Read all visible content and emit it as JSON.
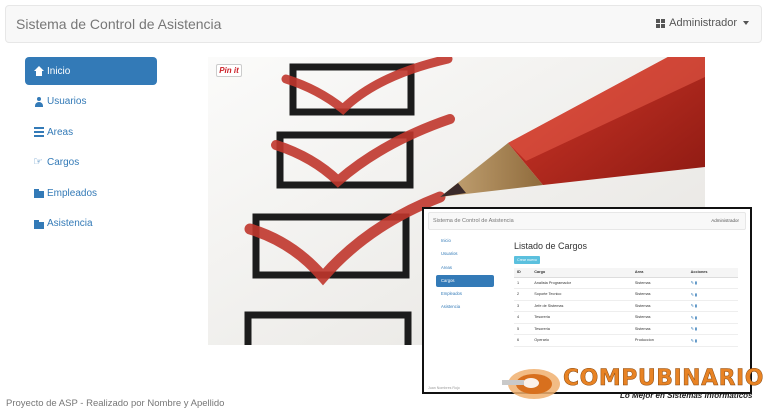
{
  "app": {
    "title": "Sistema de Control de Asistencia",
    "user_menu": "Administrador"
  },
  "sidebar": {
    "items": [
      {
        "label": "Inicio",
        "icon": "home-icon",
        "active": true
      },
      {
        "label": "Usuarios",
        "icon": "user-icon"
      },
      {
        "label": "Areas",
        "icon": "list-icon"
      },
      {
        "label": "Cargos",
        "icon": "hand-point-icon"
      },
      {
        "label": "Empleados",
        "icon": "folder-icon"
      },
      {
        "label": "Asistencia",
        "icon": "folder-icon"
      }
    ]
  },
  "hero": {
    "pin_label": "Pin it",
    "image": "checklist-with-red-pencil"
  },
  "inset": {
    "brand": "Sistema de Control de Asistencia",
    "user_menu": "Administrador",
    "nav": [
      "Inicio",
      "Usuarios",
      "Areas",
      "Cargos",
      "Empleados",
      "Asistencia"
    ],
    "page_title": "Listado de Cargos",
    "new_button": "Crear nuevo Cargo",
    "columns": [
      "ID",
      "Cargo",
      "Area",
      "Acciones"
    ],
    "rows": [
      {
        "id": "1",
        "cargo": "Analista Programador",
        "area": "Sistemas"
      },
      {
        "id": "2",
        "cargo": "Soporte Tecnico",
        "area": "Sistemas"
      },
      {
        "id": "3",
        "cargo": "Jefe de Sistemas",
        "area": "Sistemas"
      },
      {
        "id": "4",
        "cargo": "Tesoreria",
        "area": "Sistemas"
      },
      {
        "id": "5",
        "cargo": "Tesoreria",
        "area": "Sistemas"
      },
      {
        "id": "6",
        "cargo": "Operario",
        "area": "Produccion"
      }
    ],
    "footer": "Juan Nombres Rojo"
  },
  "watermark": {
    "brand": "COMPUBINARIO",
    "tagline": "Lo Mejor en Sistemas Informáticos"
  },
  "footer": {
    "text": "Proyecto de ASP - Realizado por Nombre y Apellido"
  },
  "colors": {
    "primary": "#337ab7",
    "navbar_bg": "#f8f8f8",
    "check_red": "#c0362c",
    "logo_orange": "#e88324"
  }
}
